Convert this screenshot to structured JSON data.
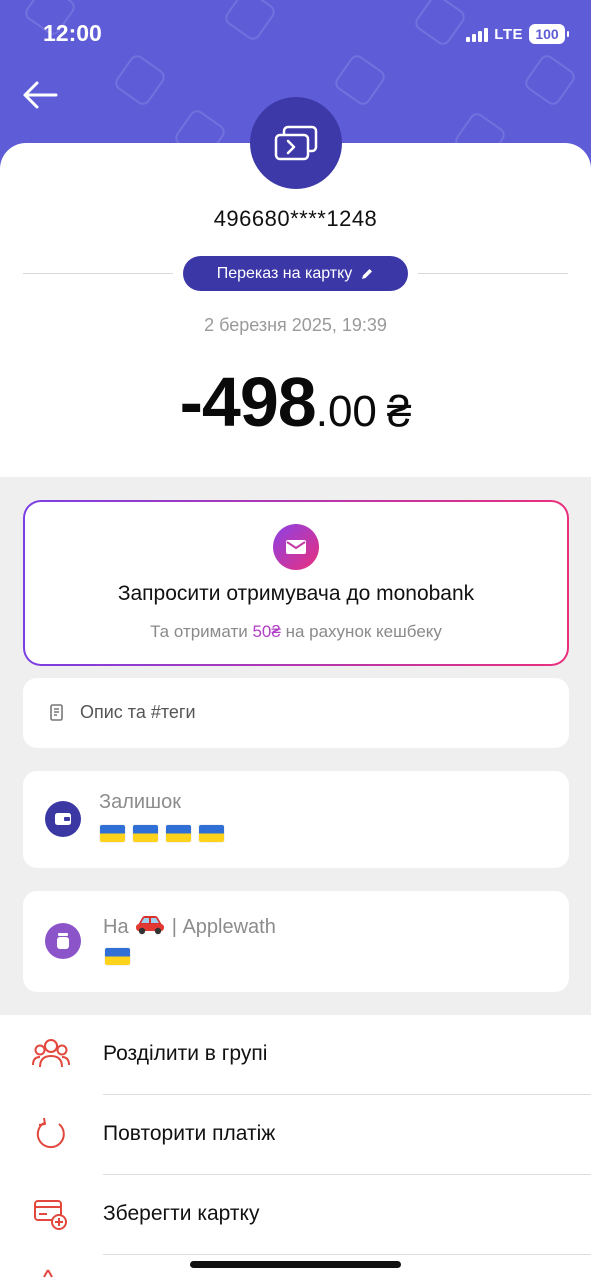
{
  "status_bar": {
    "time": "12:00",
    "network": "LTE",
    "battery": "100"
  },
  "header": {
    "back_icon": "arrow-left-icon",
    "avatar_icon": "card-transfer-icon"
  },
  "transaction": {
    "card_number": "496680****1248",
    "type_label": "Переказ на картку",
    "type_edit_icon": "pencil-icon",
    "date": "2 березня 2025, 19:39",
    "amount_main": "-498",
    "amount_decimal": ".00",
    "currency": "₴"
  },
  "invite": {
    "icon": "envelope-icon",
    "title": "Запросити отримувача до monobank",
    "sub_before": "Та отримати",
    "sub_accent": "50₴",
    "sub_after": "на рахунок кешбеку",
    "accent_color": "#b03dc6"
  },
  "description": {
    "icon": "note-icon",
    "label": "Опис та #теги"
  },
  "balance": {
    "icon": "wallet-icon",
    "title": "Залишок",
    "flags": [
      "ukraine-flag",
      "ukraine-flag",
      "ukraine-flag",
      "ukraine-flag"
    ]
  },
  "jar": {
    "icon": "jar-icon",
    "title_prefix": "На",
    "title_emoji": "car-emoji",
    "title_suffix": "| Applewath",
    "flags": [
      "ukraine-flag"
    ]
  },
  "actions": [
    {
      "label": "Розділити в групі",
      "icon": "group-people-icon"
    },
    {
      "label": "Повторити платіж",
      "icon": "repeat-icon"
    },
    {
      "label": "Зберегти картку",
      "icon": "card-add-icon"
    }
  ],
  "colors": {
    "header": "#5f5cd8",
    "pill": "#3c37a6",
    "action_icons": "#e2483d",
    "invite_gradient": [
      "#7b3fe4",
      "#ea2f7c"
    ]
  }
}
